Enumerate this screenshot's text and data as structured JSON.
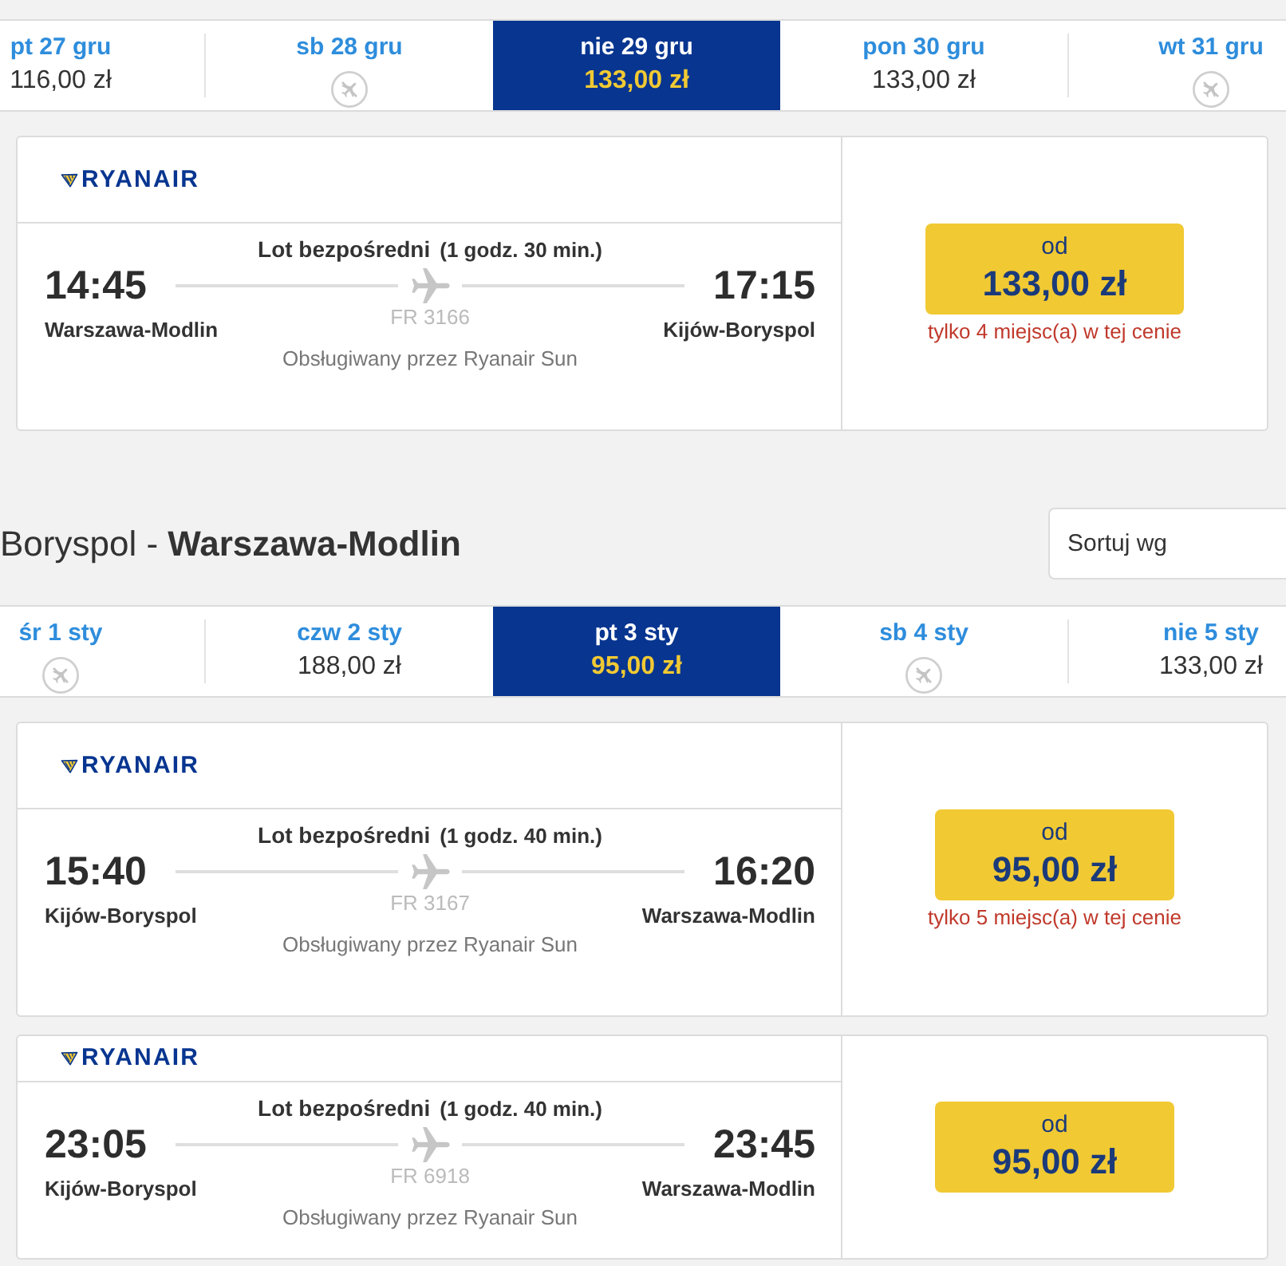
{
  "sections": [
    {
      "dates": [
        {
          "label": "pt 27 gru",
          "kind": "fare",
          "price": "116,00 zł",
          "selected": false
        },
        {
          "label": "sb 28 gru",
          "kind": "no-flights",
          "selected": false
        },
        {
          "label": "nie 29 gru",
          "kind": "fare",
          "price": "133,00 zł",
          "selected": true
        },
        {
          "label": "pon 30 gru",
          "kind": "fare",
          "price": "133,00 zł",
          "selected": false
        },
        {
          "label": "wt 31 gru",
          "kind": "no-flights",
          "selected": false
        }
      ],
      "flights": [
        {
          "airline": "RYANAIR",
          "connection": "Lot bezpośredni",
          "duration": "(1 godz. 30 min.)",
          "departure": {
            "time": "14:45",
            "airport": "Warszawa-Modlin"
          },
          "arrival": {
            "time": "17:15",
            "airport": "Kijów-Boryspol"
          },
          "flight_number": "FR 3166",
          "operator": "Obsługiwany przez Ryanair Sun",
          "price_label": "od",
          "price": "133,00 zł",
          "seats_note": "tylko 4 miejsc(a) w tej cenie"
        }
      ]
    },
    {
      "title": "Boryspol - **Warszawa-Modlin**",
      "sort": {
        "placeholder": "Sortuj wg"
      },
      "dates": [
        {
          "label": "śr 1 sty",
          "kind": "no-flights",
          "selected": false
        },
        {
          "label": "czw 2 sty",
          "kind": "fare",
          "price": "188,00 zł",
          "selected": false
        },
        {
          "label": "pt 3 sty",
          "kind": "fare",
          "price": "95,00 zł",
          "selected": true
        },
        {
          "label": "sb 4 sty",
          "kind": "no-flights",
          "selected": false
        },
        {
          "label": "nie 5 sty",
          "kind": "fare",
          "price": "133,00 zł",
          "selected": false
        }
      ],
      "flights": [
        {
          "airline": "RYANAIR",
          "connection": "Lot bezpośredni",
          "duration": "(1 godz. 40 min.)",
          "departure": {
            "time": "15:40",
            "airport": "Kijów-Boryspol"
          },
          "arrival": {
            "time": "16:20",
            "airport": "Warszawa-Modlin"
          },
          "flight_number": "FR 3167",
          "operator": "Obsługiwany przez Ryanair Sun",
          "price_label": "od",
          "price": "95,00 zł",
          "seats_note": "tylko 5 miejsc(a) w tej cenie"
        },
        {
          "airline": "RYANAIR",
          "connection": "Lot bezpośredni",
          "duration": "(1 godz. 40 min.)",
          "departure": {
            "time": "23:05",
            "airport": "Kijów-Boryspol"
          },
          "arrival": {
            "time": "23:45",
            "airport": "Warszawa-Modlin"
          },
          "flight_number": "FR 6918",
          "operator": "Obsługiwany przez Ryanair Sun",
          "price_label": "od",
          "price": "95,00 zł"
        }
      ]
    }
  ]
}
